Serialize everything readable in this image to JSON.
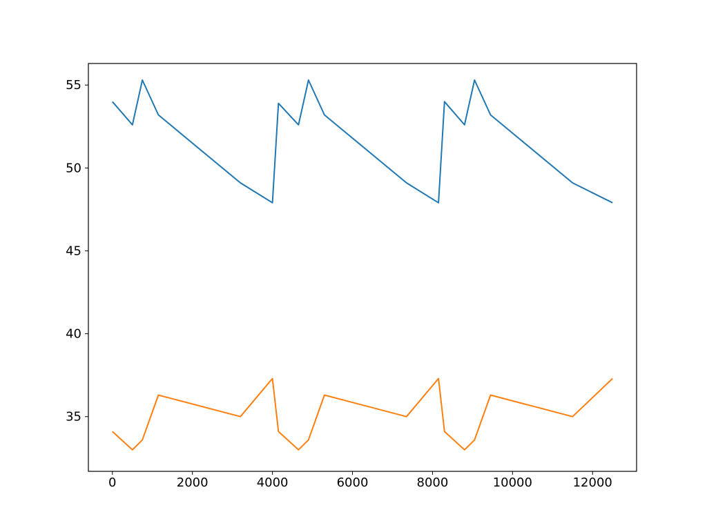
{
  "chart_data": {
    "type": "line",
    "xlim": [
      -600,
      13100
    ],
    "ylim": [
      31.7,
      56.3
    ],
    "x_ticks": [
      0,
      2000,
      4000,
      6000,
      8000,
      10000,
      12000
    ],
    "x_tick_labels": [
      "0",
      "2000",
      "4000",
      "6000",
      "8000",
      "10000",
      "12000"
    ],
    "y_ticks": [
      35,
      40,
      45,
      50,
      55
    ],
    "y_tick_labels": [
      "35",
      "40",
      "45",
      "50",
      "55"
    ],
    "x": [
      0,
      500,
      750,
      1150,
      3200,
      4000,
      4150,
      4650,
      4900,
      5300,
      7350,
      8150,
      8300,
      8800,
      9050,
      9450,
      11500,
      12500
    ],
    "series": [
      {
        "name": "series-0",
        "color": "#1f77b4",
        "values": [
          54.0,
          52.6,
          55.3,
          53.2,
          49.1,
          47.9,
          53.9,
          52.6,
          55.3,
          53.2,
          49.1,
          47.9,
          54.0,
          52.6,
          55.3,
          53.2,
          49.1,
          47.9
        ]
      },
      {
        "name": "series-1",
        "color": "#ff7f0e",
        "values": [
          34.1,
          33.0,
          33.6,
          36.3,
          35.0,
          37.3,
          34.1,
          33.0,
          33.6,
          36.3,
          35.0,
          37.3,
          34.1,
          33.0,
          33.6,
          36.3,
          35.0,
          37.3
        ]
      }
    ],
    "title": "",
    "xlabel": "",
    "ylabel": "",
    "grid": false,
    "legend": false
  },
  "colors": {
    "axis": "#000000",
    "bg": "#ffffff"
  }
}
